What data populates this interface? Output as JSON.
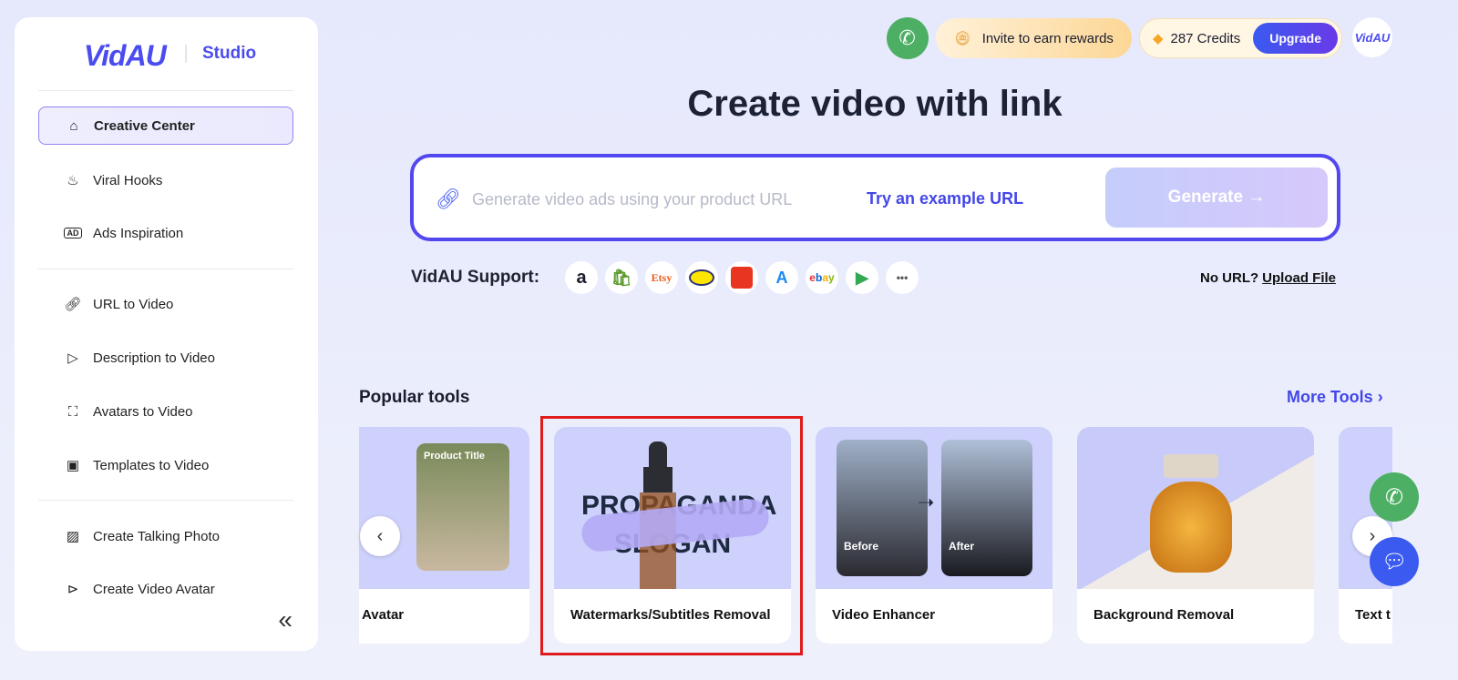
{
  "sidebar": {
    "logo": "VidAU",
    "studio": "Studio",
    "items": [
      {
        "label": "Creative Center",
        "icon": "home-icon",
        "active": true
      },
      {
        "label": "Viral Hooks",
        "icon": "fire-icon"
      },
      {
        "label": "Ads Inspiration",
        "icon": "ad-icon"
      },
      {
        "label": "URL to Video",
        "icon": "link-icon"
      },
      {
        "label": "Description to Video",
        "icon": "document-video-icon"
      },
      {
        "label": "Avatars to Video",
        "icon": "avatar-scan-icon"
      },
      {
        "label": "Templates to Video",
        "icon": "template-icon"
      },
      {
        "label": "Create Talking Photo",
        "icon": "image-icon"
      },
      {
        "label": "Create Video Avatar",
        "icon": "video-avatar-icon"
      }
    ],
    "collapse_icon": "double-chevron-left-icon"
  },
  "header": {
    "invite": "Invite to earn rewards",
    "credits": "287 Credits",
    "upgrade": "Upgrade",
    "avatar": "VidAU"
  },
  "main": {
    "title": "Create video with link",
    "url_placeholder": "Generate video ads using your product URL",
    "url_value": "",
    "try_example": "Try an example URL",
    "generate": "Generate →",
    "support_label": "VidAU Support:",
    "platforms": [
      "amazon",
      "shopify",
      "Etsy",
      "mercadolibre",
      "aliexpress",
      "app-store",
      "ebay",
      "google-play",
      "more"
    ],
    "no_url": "No URL?",
    "upload_file": "Upload File",
    "popular_tools": "Popular tools",
    "more_tools": "More Tools",
    "tools": [
      {
        "label": "Avatar",
        "image_text": "Product Title"
      },
      {
        "label": "Watermarks/Subtitles Removal",
        "image_text": [
          "PROPAGANDA",
          "SLOGAN"
        ]
      },
      {
        "label": "Video Enhancer",
        "image_text": [
          "Before",
          "After"
        ]
      },
      {
        "label": "Background Removal"
      },
      {
        "label": "Text t"
      }
    ]
  },
  "colors": {
    "accent": "#4a4cf0",
    "highlight": "#e01b1b",
    "whatsapp": "#4caf63"
  }
}
